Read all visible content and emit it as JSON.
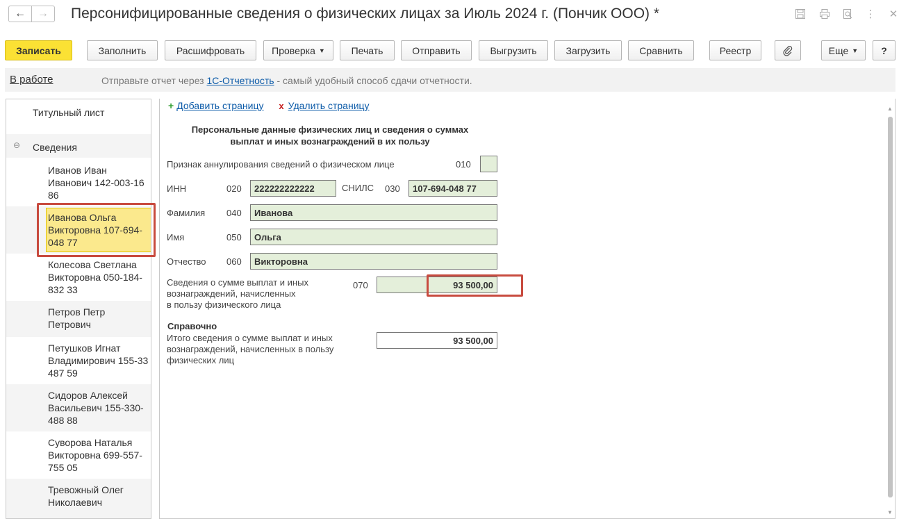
{
  "window": {
    "title": "Персонифицированные сведения о физических лицах за Июль 2024 г. (Пончик ООО) *",
    "back_icon": "←",
    "forward_icon": "→",
    "save_icon": "💾",
    "print_icon": "⎙",
    "preview_icon": "🔍",
    "more_icon": "⋮",
    "close_icon": "✕"
  },
  "toolbar": {
    "write": "Записать",
    "fill": "Заполнить",
    "decode": "Расшифровать",
    "check": "Проверка",
    "print": "Печать",
    "send": "Отправить",
    "unload": "Выгрузить",
    "load": "Загрузить",
    "compare": "Сравнить",
    "registry": "Реестр",
    "attach_icon": "📎",
    "more": "Еще",
    "help": "?"
  },
  "status": {
    "state": "В работе",
    "msg_before": "Отправьте отчет через ",
    "msg_link": "1С-Отчетность",
    "msg_after": " - самый удобный способ сдачи отчетности."
  },
  "tree": {
    "title_page": "Титульный лист",
    "section": "Сведения",
    "toggle": "⊖",
    "persons": [
      "Иванов Иван Иванович 142-003-16 86",
      "Иванова Ольга Викторовна 107-694-048 77",
      "Колесова Светлана Викторовна 050-184-832 33",
      "Петров Петр Петрович",
      "Петушков Игнат Владимирович 155-33 487 59",
      "Сидоров Алексей Васильевич 155-330-488 88",
      "Суворова Наталья Викторовна 699-557-755 05",
      "Тревожный Олег Николаевич"
    ]
  },
  "form": {
    "add_page": "Добавить страницу",
    "delete_page": "Удалить страницу",
    "plus_icon": "+",
    "x_icon": "x",
    "heading_line1": "Персональные данные физических лиц и сведения о суммах",
    "heading_line2": "выплат и иных вознаграждений в их пользу",
    "annul_label": "Признак аннулирования сведений о физическом лице",
    "annul_code": "010",
    "inn_label": "ИНН",
    "inn_code": "020",
    "inn_value": "222222222222",
    "snils_label": "СНИЛС",
    "snils_code": "030",
    "snils_value": "107-694-048 77",
    "surname_label": "Фамилия",
    "surname_code": "040",
    "surname_value": "Иванова",
    "name_label": "Имя",
    "name_code": "050",
    "name_value": "Ольга",
    "patronymic_label": "Отчество",
    "patronymic_code": "060",
    "patronymic_value": "Викторовна",
    "payments_label_1": "Сведения о сумме выплат и иных",
    "payments_label_2": "вознаграждений, начисленных",
    "payments_label_3": "в пользу физического лица",
    "payments_code": "070",
    "payments_value": "93 500,00",
    "ref_title": "Справочно",
    "total_label_1": "Итого сведения о сумме выплат и иных",
    "total_label_2": "вознаграждений, начисленных в пользу",
    "total_label_3": "физических лиц",
    "total_value": "93 500,00"
  },
  "colors": {
    "accent_yellow": "#fbe134",
    "selected_bg": "#fbe98d",
    "highlight_frame": "#c84b3f",
    "field_bg": "#e4efda",
    "link": "#0b5aa8"
  }
}
